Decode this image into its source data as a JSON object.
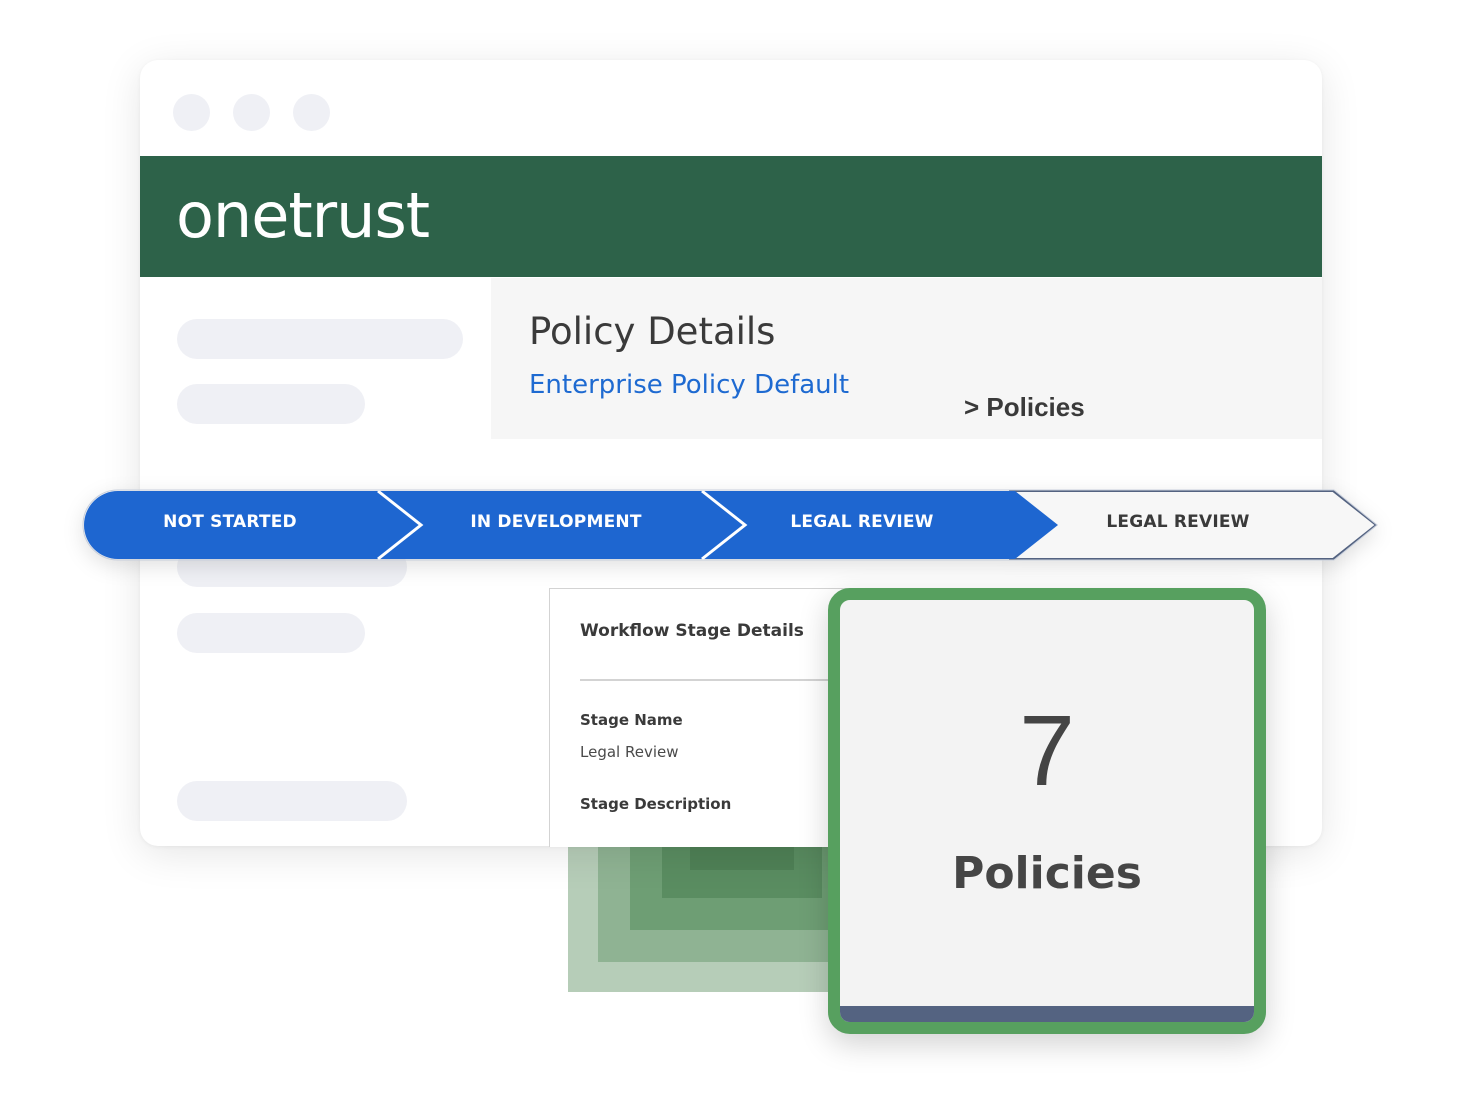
{
  "window": {
    "controls": [
      "window-dot",
      "window-dot",
      "window-dot"
    ]
  },
  "brand": {
    "logo_text": "onetrust",
    "bar_color": "#2d6249"
  },
  "page": {
    "title": "Policy Details",
    "subtitle": "Enterprise Policy Default",
    "breadcrumb": "> Policies"
  },
  "workflow": {
    "active_color": "#1e66d0",
    "stages": [
      {
        "label": "NOT STARTED",
        "state": "complete"
      },
      {
        "label": "IN DEVELOPMENT",
        "state": "complete"
      },
      {
        "label": "LEGAL REVIEW",
        "state": "complete"
      },
      {
        "label": "LEGAL REVIEW",
        "state": "pending"
      }
    ]
  },
  "details": {
    "title": "Workflow Stage Details",
    "stage_name_label": "Stage Name",
    "stage_name_value": "Legal Review",
    "stage_description_label": "Stage Description"
  },
  "count_card": {
    "number": "7",
    "label": "Policies",
    "border_color": "#57a05f"
  }
}
